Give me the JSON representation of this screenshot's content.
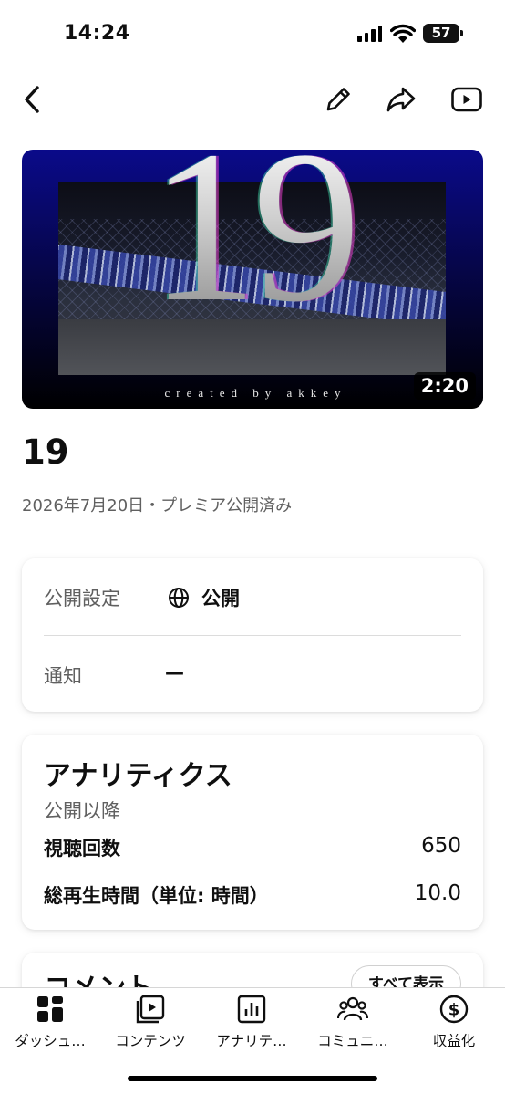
{
  "status_bar": {
    "time": "14:24",
    "battery": "57"
  },
  "video": {
    "thumbnail_number": "19",
    "thumbnail_credit": "created by akkey",
    "duration": "2:20",
    "title": "19",
    "meta": "2026年7月20日・プレミア公開済み"
  },
  "settings": {
    "visibility_label": "公開設定",
    "visibility_value": "公開",
    "notify_label": "通知",
    "notify_value": "—"
  },
  "analytics": {
    "title": "アナリティクス",
    "subtitle": "公開以降",
    "rows": [
      {
        "label": "視聴回数",
        "value": "650"
      },
      {
        "label": "総再生時間（単位: 時間）",
        "value": "10.0"
      }
    ]
  },
  "comments": {
    "title": "コメント",
    "show_all": "すべて表示"
  },
  "nav": [
    {
      "label": "ダッシュ…",
      "icon": "dashboard-icon"
    },
    {
      "label": "コンテンツ",
      "icon": "content-icon"
    },
    {
      "label": "アナリテ…",
      "icon": "analytics-icon"
    },
    {
      "label": "コミュニ…",
      "icon": "community-icon"
    },
    {
      "label": "収益化",
      "icon": "earn-icon"
    }
  ]
}
